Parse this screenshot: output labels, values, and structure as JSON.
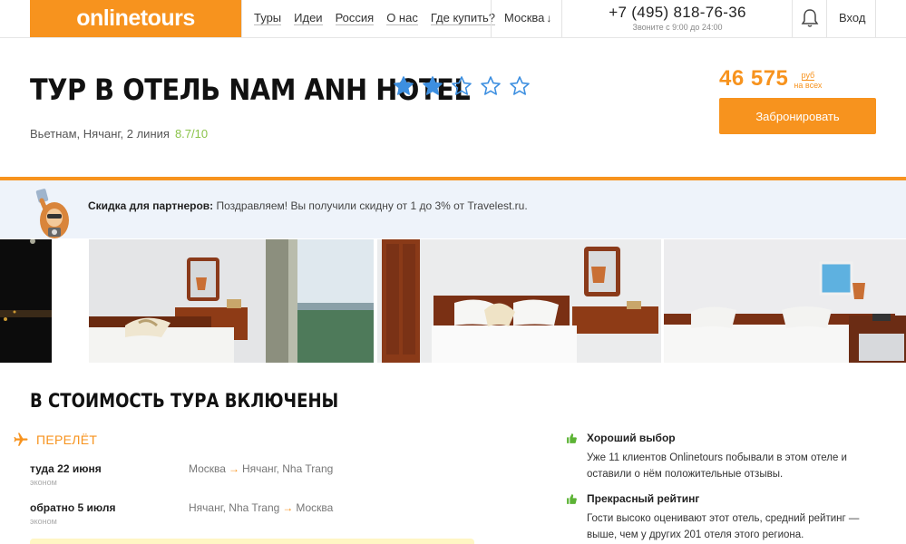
{
  "header": {
    "logo": "onlinetours",
    "nav": [
      "Туры",
      "Идеи",
      "Россия",
      "О нас",
      "Где купить?"
    ],
    "city": "Москва",
    "phone": "+7 (495) 818-76-36",
    "phone_hours": "Звоните с 9:00 до 24:00",
    "login": "Вход"
  },
  "hotel": {
    "title": "ТУР В ОТЕЛЬ NAM ANH HOTEL",
    "stars_filled": 2,
    "stars_total": 5,
    "location": "Вьетнам, Нячанг, 2 линия",
    "rating": "8.7/10"
  },
  "price": {
    "value": "46 575",
    "currency": "руб",
    "per": "на всех",
    "book_label": "Забронировать"
  },
  "banner": {
    "label": "Скидка для партнеров:",
    "text": " Поздравляем! Вы получили скидну от 1 до 3% от Travelest.ru."
  },
  "included": {
    "title": "В СТОИМОСТЬ ТУРА ВКЛЮЧЕНЫ",
    "flight_label": "ПЕРЕЛЁТ",
    "flights": [
      {
        "dir": "туда 22 июня",
        "cls": "эконом",
        "from": "Москва",
        "to": "Нячанг, Nha Trang"
      },
      {
        "dir": "обратно 5 июля",
        "cls": "эконом",
        "from": "Нячанг, Nha Trang",
        "to": "Москва"
      }
    ],
    "perks": [
      {
        "title": "Хороший выбор",
        "text": "Уже 11 клиентов Onlinetours побывали в этом отеле и оставили о нём положительные отзывы."
      },
      {
        "title": "Прекрасный рейтинг",
        "text": "Гости высоко оценивают этот отель, средний рейтинг — выше, чем у других 201 отеля этого региона."
      }
    ]
  },
  "colors": {
    "brand": "#f7931e",
    "star": "#3d8fe0",
    "rating": "#8bc34a",
    "banner_bg": "#eef3fa",
    "perk_icon": "#5cb335"
  }
}
